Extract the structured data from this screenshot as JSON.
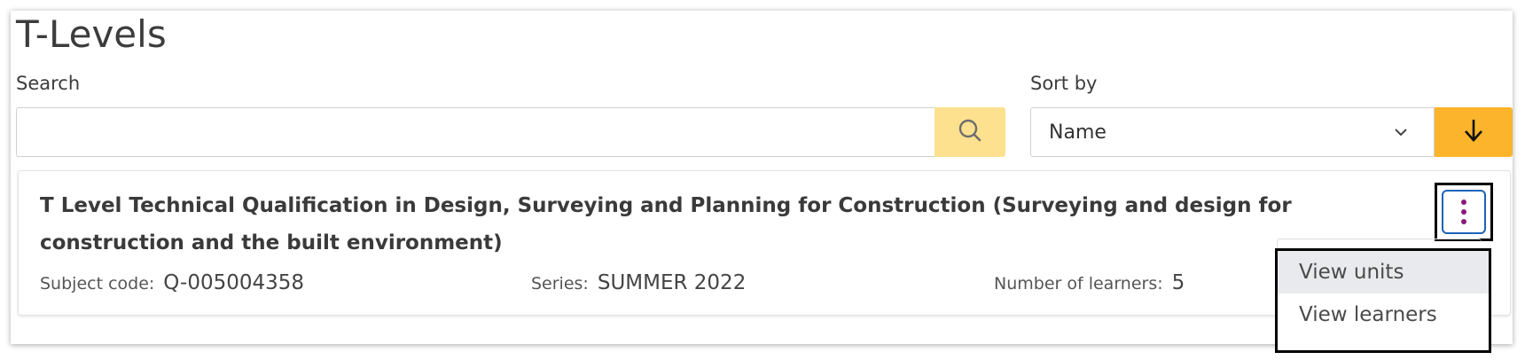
{
  "page": {
    "title": "T-Levels"
  },
  "search": {
    "label": "Search",
    "value": "",
    "placeholder": "",
    "button_icon": "search-icon"
  },
  "sort": {
    "label": "Sort by",
    "selected": "Name",
    "select_icon": "chevron-down-icon",
    "direction_icon": "arrow-down-icon"
  },
  "qualification": {
    "title": "T Level Technical Qualification in Design, Surveying and Planning for Construction (Surveying and design for construction and the built environment)",
    "subject_code_label": "Subject code:",
    "subject_code": "Q-005004358",
    "series_label": "Series:",
    "series": "SUMMER 2022",
    "learners_label": "Number of learners:",
    "learners": "5",
    "actions_icon": "kebab-menu-icon"
  },
  "menu": {
    "items": [
      {
        "label": "View units",
        "highlighted": true
      },
      {
        "label": "View learners",
        "highlighted": false
      }
    ]
  },
  "colors": {
    "search_button": "#fde18f",
    "sort_button": "#fbb42c",
    "kebab_border": "#1c63b7",
    "kebab_dots": "#8b1a7a"
  }
}
